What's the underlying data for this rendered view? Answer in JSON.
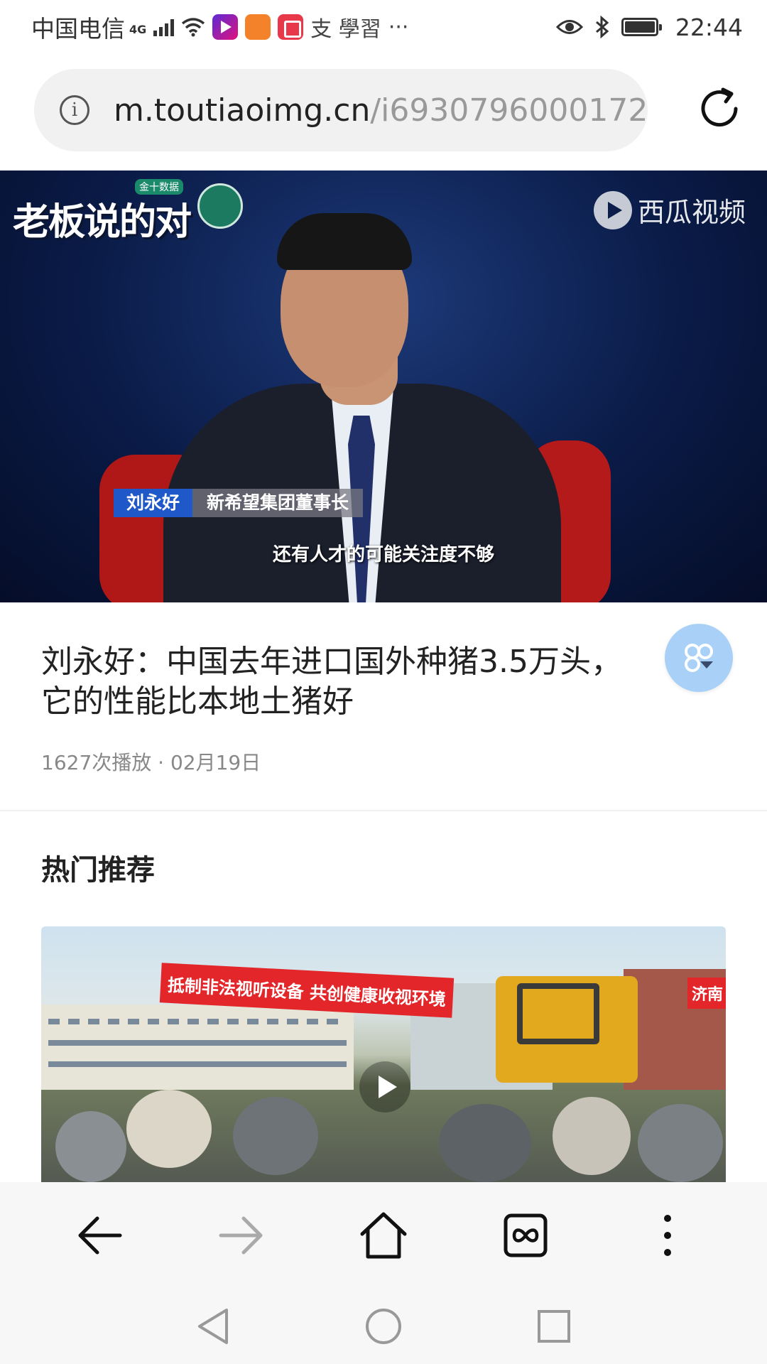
{
  "status_bar": {
    "carrier": "中国电信",
    "network_type": "4G",
    "app_text": "支 學習",
    "more": "···",
    "time": "22:44"
  },
  "browser": {
    "url_domain": "m.toutiaoimg.cn",
    "url_path": "/i6930796000172"
  },
  "video": {
    "show_logo": "老板说的对",
    "show_badge": "金十数据",
    "brand": "西瓜视频",
    "speaker_name": "刘永好",
    "speaker_title": "新希望集团董事长",
    "caption": "还有人才的可能关注度不够"
  },
  "article": {
    "title": "刘永好：中国去年进口国外种猪3.5万头，它的性能比本地土猪好",
    "meta": "1627次播放 · 02月19日"
  },
  "recommended": {
    "heading": "热门推荐",
    "card": {
      "banner": "抵制非法视听设备 共创健康收视环境",
      "banner_right": "济南"
    }
  },
  "toolbar": {
    "icons": [
      "back-arrow-icon",
      "forward-arrow-icon",
      "home-icon",
      "tabs-icon",
      "more-vertical-icon"
    ]
  },
  "system_nav": {
    "icons": [
      "back-triangle-icon",
      "home-circle-icon",
      "recent-square-icon"
    ]
  }
}
